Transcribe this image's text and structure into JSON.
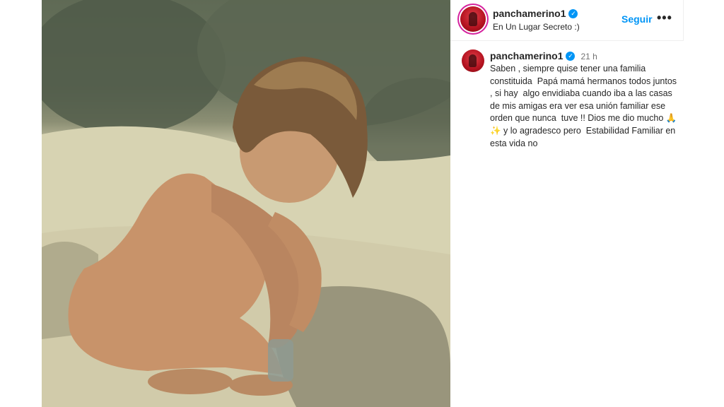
{
  "post": {
    "image_alt": "Fotografía vintage de una niña agachada jugando en la arena"
  },
  "header": {
    "username": "panchamerino1",
    "location": "En Un Lugar Secreto :)",
    "follow_label": "Seguir",
    "more_label": "•••"
  },
  "caption": {
    "username": "panchamerino1",
    "time": "21 h",
    "text_part1": "Saben , siempre quise tener una familia constituida  Papá mamá hermanos todos juntos , si hay  algo envidiaba cuando iba a las casas de mis amigas era ver esa unión familiar ese orden que nunca  tuve !! Dios me dio mucho ",
    "emoji1": "🙏",
    "emoji2": "✨",
    "text_part2": " y lo agradesco pero  Estabilidad Familiar en  esta vida no"
  },
  "icons": {
    "verified": "verified-badge-icon",
    "avatar": "profile-avatar"
  },
  "colors": {
    "accent": "#0095f6",
    "text": "#262626",
    "muted": "#737373"
  }
}
